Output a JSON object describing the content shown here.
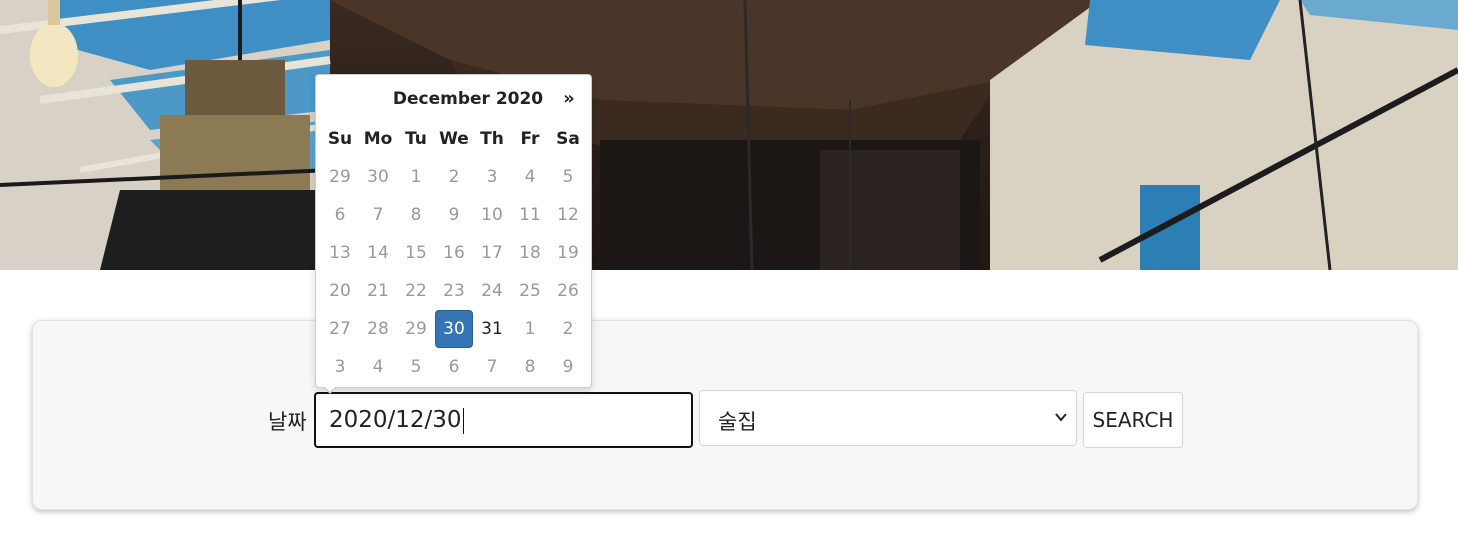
{
  "search_form": {
    "date_label": "날짜",
    "date_value": "2020/12/30",
    "category_value": "술집",
    "search_button_label": "SEARCH"
  },
  "datepicker": {
    "title": "December 2020",
    "next_symbol": "»",
    "weekdays": [
      "Su",
      "Mo",
      "Tu",
      "We",
      "Th",
      "Fr",
      "Sa"
    ],
    "weeks": [
      [
        "29",
        "30",
        "1",
        "2",
        "3",
        "4",
        "5"
      ],
      [
        "6",
        "7",
        "8",
        "9",
        "10",
        "11",
        "12"
      ],
      [
        "13",
        "14",
        "15",
        "16",
        "17",
        "18",
        "19"
      ],
      [
        "20",
        "21",
        "22",
        "23",
        "24",
        "25",
        "26"
      ],
      [
        "27",
        "28",
        "29",
        "30",
        "31",
        "1",
        "2"
      ],
      [
        "3",
        "4",
        "5",
        "6",
        "7",
        "8",
        "9"
      ]
    ],
    "current_month_days": [
      "30",
      "31"
    ],
    "selected_day": "30"
  },
  "colors": {
    "selected_day_bg": "#3376b3",
    "panel_bg": "#f7f7f8"
  }
}
